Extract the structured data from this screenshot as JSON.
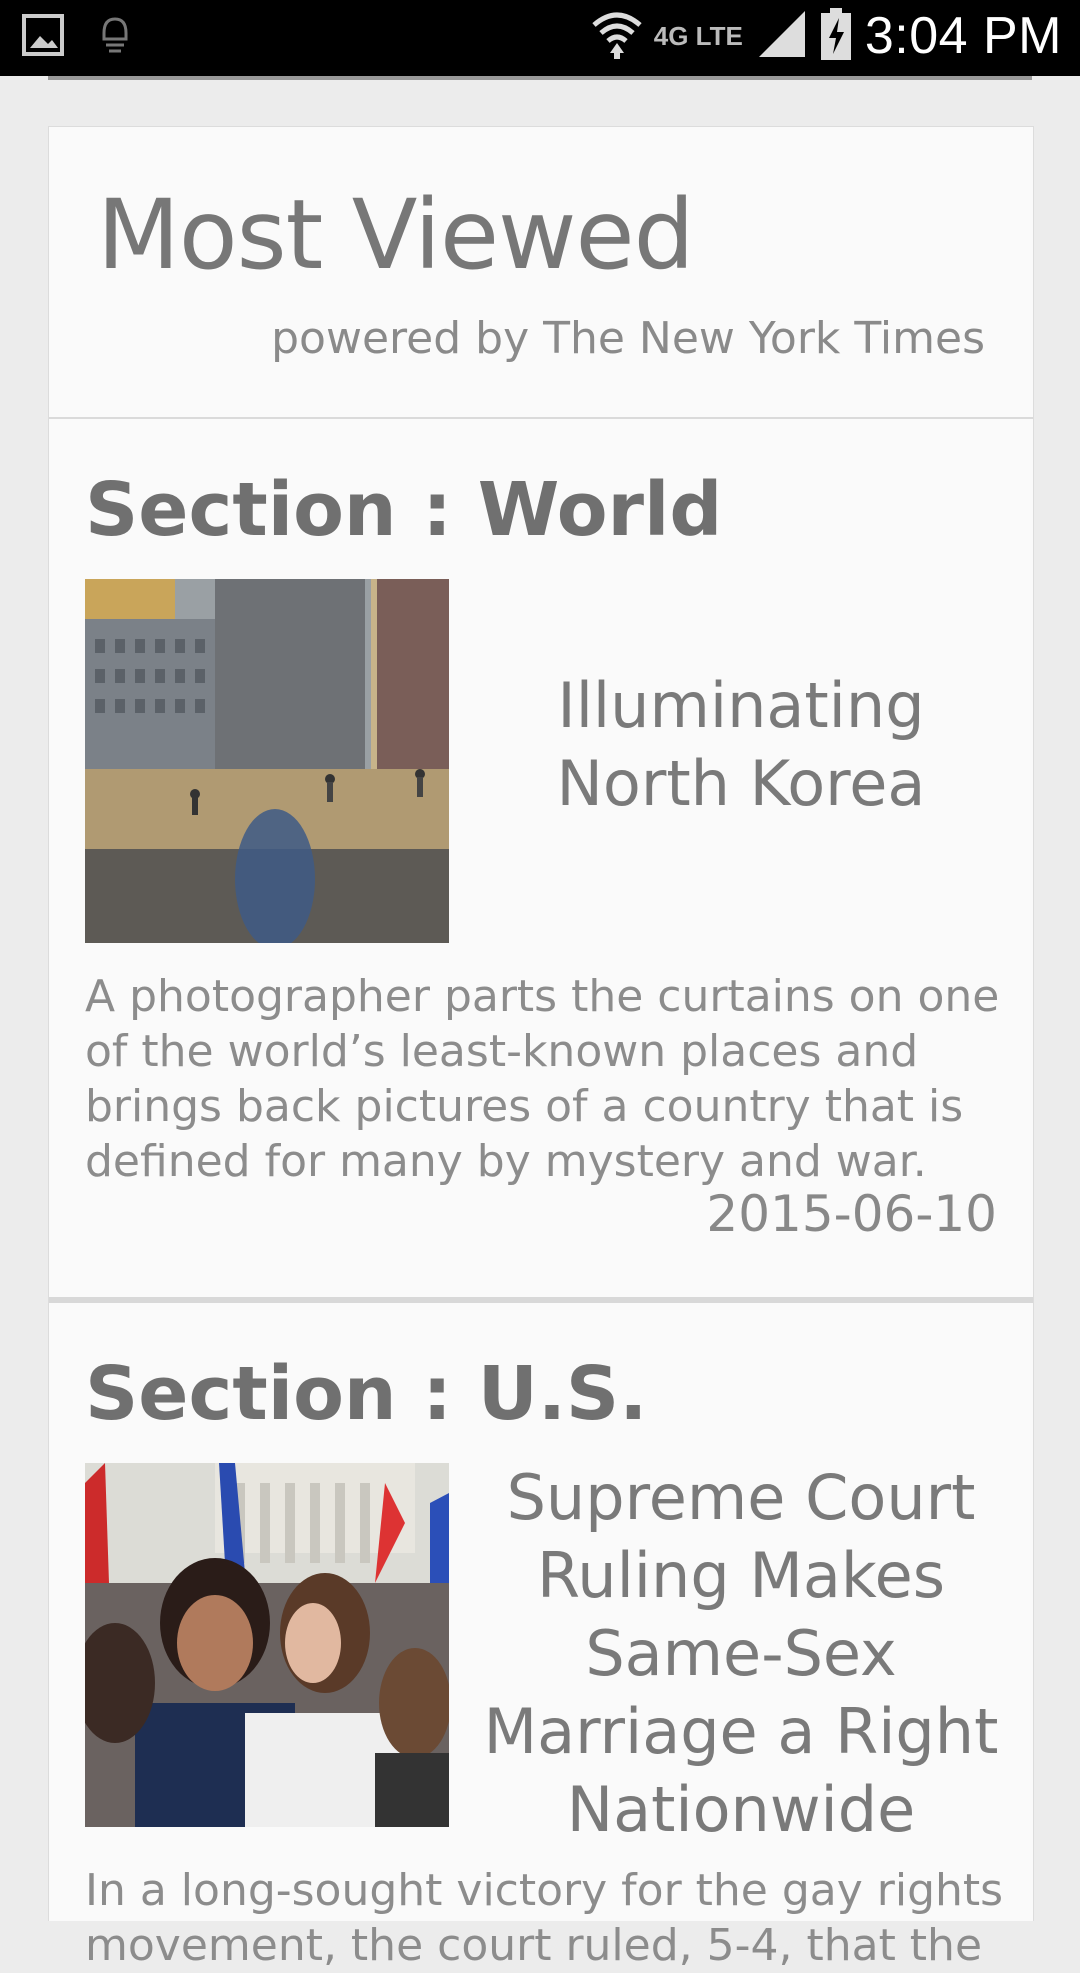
{
  "status_bar": {
    "time": "3:04 PM",
    "network": "4G LTE",
    "icons": [
      "gallery-icon",
      "notification-icon",
      "wifi-icon",
      "signal-icon",
      "battery-charging-icon"
    ]
  },
  "header": {
    "title": "Most Viewed",
    "subtitle": "powered by The New York Times"
  },
  "articles": [
    {
      "section": "Section : World",
      "headline": "Illuminating North Korea",
      "description": "A photographer parts the curtains on one of the world’s least-known places and brings back pictures of a country that is defined for many by mystery and war.",
      "date": "2015-06-10"
    },
    {
      "section": "Section : U.S.",
      "headline": "Supreme Court Ruling Makes Same-Sex Marriage a Right Nationwide",
      "description": "In a long-sought victory for the gay rights movement, the court ruled, 5-4, that the"
    }
  ],
  "colors": {
    "background": "#ececec",
    "card": "#fafafa",
    "text_gray": "#777777"
  }
}
